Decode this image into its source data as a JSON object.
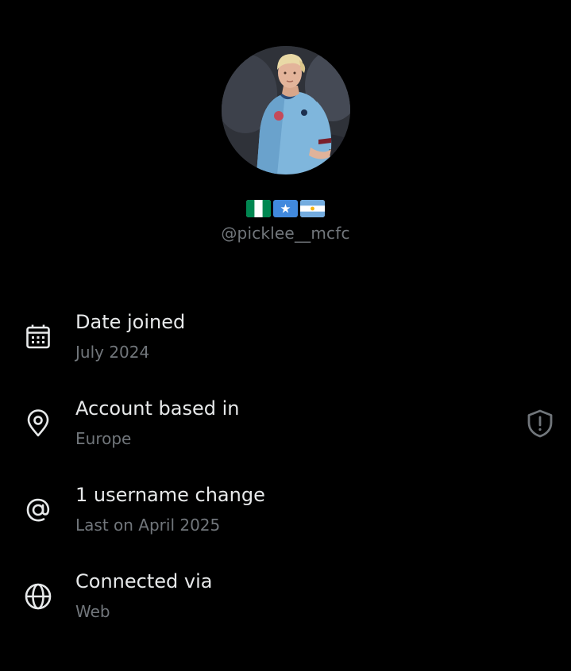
{
  "profile": {
    "handle": "@picklee__mcfc",
    "flags": [
      "nigeria-flag",
      "somalia-flag",
      "argentina-flag"
    ]
  },
  "details": [
    {
      "title": "Date joined",
      "sub": "July 2024",
      "icon": "calendar-icon"
    },
    {
      "title": "Account based in",
      "sub": "Europe",
      "icon": "location-pin-icon",
      "badge_icon": "shield-alert-icon"
    },
    {
      "title": "1 username change",
      "sub": "Last on April 2025",
      "icon": "at-sign-icon"
    },
    {
      "title": "Connected via",
      "sub": "Web",
      "icon": "globe-icon"
    }
  ],
  "colors": {
    "background": "#000000",
    "primary_text": "#e7e9ea",
    "secondary_text": "#71767b"
  }
}
